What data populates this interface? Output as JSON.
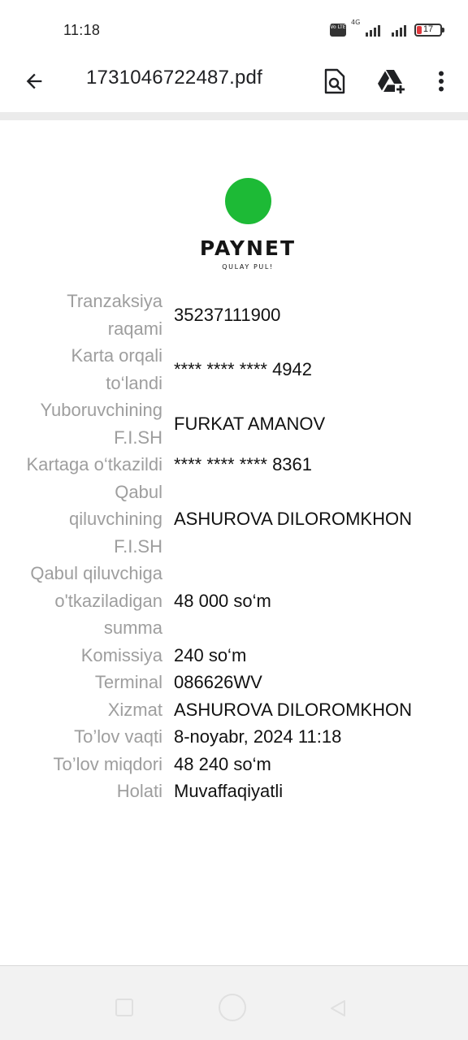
{
  "status_bar": {
    "time": "11:18",
    "volte": "Vo LTE",
    "network": "4G",
    "battery_level": "17",
    "battery_color": "#e0393e"
  },
  "app_bar": {
    "back_icon": "arrow-back-icon",
    "title": "1731046722487.pdf",
    "search_icon": "search-in-document-icon",
    "drive_icon": "add-to-drive-icon",
    "more_icon": "more-vert-icon"
  },
  "logo": {
    "brand": "PAYNET",
    "tagline": "QULAY PUL!",
    "brand_color": "#1dba36"
  },
  "receipt": [
    {
      "label_lines": [
        "Tranzaksiya",
        "raqami"
      ],
      "value": "35237111900"
    },
    {
      "label_lines": [
        "Karta orqali",
        "to‘landi"
      ],
      "value": "**** **** **** 4942"
    },
    {
      "label_lines": [
        "Yuboruvchining",
        "F.I.SH"
      ],
      "value": "FURKAT AMANOV"
    },
    {
      "label_lines": [
        "Kartaga o‘tkazildi"
      ],
      "value": "**** **** **** 8361"
    },
    {
      "label_lines": [
        "Qabul",
        "qiluvchining",
        "F.I.SH"
      ],
      "value": "ASHUROVA DILOROMKHON"
    },
    {
      "label_lines": [
        "Qabul qiluvchiga",
        "o'tkaziladigan",
        "summa"
      ],
      "value": "48 000 so‘m"
    },
    {
      "label_lines": [
        "Komissiya"
      ],
      "value": "240 so‘m"
    },
    {
      "label_lines": [
        "Terminal"
      ],
      "value": "086626WV"
    },
    {
      "label_lines": [
        "Xizmat"
      ],
      "value": "ASHUROVA DILOROMKHON"
    },
    {
      "label_lines": [
        "To’lov vaqti"
      ],
      "value": "8-noyabr, 2024 11:18"
    },
    {
      "label_lines": [
        "To’lov miqdori"
      ],
      "value": "48 240 so‘m"
    },
    {
      "label_lines": [
        "Holati"
      ],
      "value": "Muvaffaqiyatli"
    }
  ],
  "nav_bar": {
    "recent_icon": "recent-apps-icon",
    "home_icon": "home-icon",
    "back_icon": "nav-back-icon"
  }
}
